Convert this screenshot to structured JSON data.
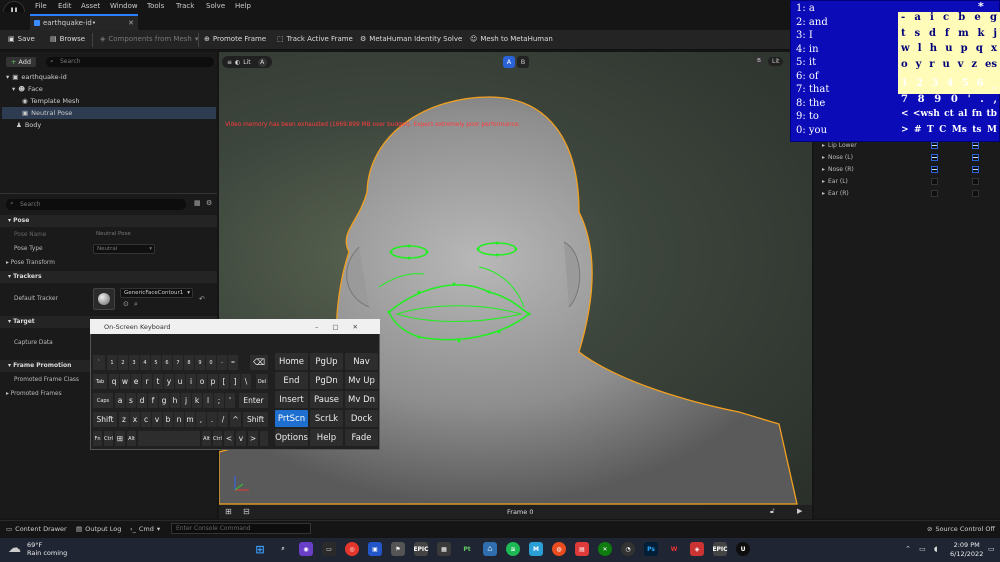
{
  "menubar": {
    "items": [
      "File",
      "Edit",
      "Asset",
      "Window",
      "Tools",
      "Track",
      "Solve",
      "Help"
    ]
  },
  "document_tab": {
    "title": "earthquake-id•"
  },
  "toolbar": {
    "save": "Save",
    "browse": "Browse",
    "components": "Components from Mesh",
    "promote": "Promote Frame",
    "track": "Track Active Frame",
    "identity_solve": "MetaHuman Identity Solve",
    "mesh_to_mh": "Mesh to MetaHuman"
  },
  "outliner": {
    "add": "Add",
    "search_placeholder": "Search",
    "tree": [
      {
        "label": "earthquake-id",
        "indent": 0
      },
      {
        "label": "Face",
        "indent": 1
      },
      {
        "label": "Template Mesh",
        "indent": 2
      },
      {
        "label": "Neutral Pose",
        "indent": 2,
        "selected": true
      },
      {
        "label": "Body",
        "indent": 1
      }
    ]
  },
  "details": {
    "search_placeholder": "Search",
    "pose_section": "Pose",
    "pose_name_label": "Pose Name",
    "pose_name_value": "Neutral Pose",
    "pose_type_label": "Pose Type",
    "pose_type_value": "Neutral",
    "pose_transform": "Pose Transform",
    "trackers_section": "Trackers",
    "default_tracker_label": "Default Tracker",
    "default_tracker_value": "GenericFaceContour1",
    "target_section": "Target",
    "capture_data_label": "Capture Data",
    "frame_promotion_section": "Frame Promotion",
    "promoted_frame_class": "Promoted Frame Class",
    "promoted_frames": "Promoted Frames"
  },
  "viewport": {
    "lit_a": "Lit",
    "view_a": "A",
    "lit_b": "Lit",
    "view_b": "B",
    "ab_a": "A",
    "ab_b": "B",
    "warning": "Video memory has been exhausted (1669.899 MB over budget). Expect extremely poor performance.",
    "frame": "Frame 0"
  },
  "right_panel": {
    "rows": [
      {
        "label": "Lip Lower",
        "c1": true,
        "c2": true
      },
      {
        "label": "Nose (L)",
        "c1": true,
        "c2": true
      },
      {
        "label": "Nose (R)",
        "c1": true,
        "c2": true
      },
      {
        "label": "Ear (L)",
        "c1": false,
        "c2": false
      },
      {
        "label": "Ear (R)",
        "c1": false,
        "c2": false
      }
    ]
  },
  "kb_helper": {
    "words": [
      "1: a",
      "2: and",
      "3: I",
      "4: in",
      "5: it",
      "6: of",
      "7: that",
      "8: the",
      "9: to",
      "0: you"
    ],
    "star": "*",
    "letter_rows": [
      [
        "-",
        "a",
        "i",
        "c",
        "b",
        "e",
        "g"
      ],
      [
        "t",
        "s",
        "d",
        "f",
        "m",
        "k",
        "j"
      ],
      [
        "w",
        "l",
        "h",
        "u",
        "p",
        "q",
        "x"
      ],
      [
        "o",
        "y",
        "r",
        "u",
        "v",
        "z",
        "es"
      ]
    ],
    "digit_rows": [
      [
        "1",
        "2",
        "3",
        "4",
        "5",
        "6",
        "_"
      ],
      [
        "7",
        "8",
        "9",
        "0",
        "'",
        ".",
        ","
      ],
      [
        "<",
        "<wsh",
        "ct",
        "al",
        "fn",
        "tb"
      ],
      [
        ">",
        "#",
        "T",
        "C",
        "Ms",
        "ts",
        "M"
      ]
    ]
  },
  "osk": {
    "title": "On-Screen Keyboard",
    "row1": [
      "`",
      "1",
      "2",
      "3",
      "4",
      "5",
      "6",
      "7",
      "8",
      "9",
      "0",
      "-",
      "="
    ],
    "row2": [
      "q",
      "w",
      "e",
      "r",
      "t",
      "y",
      "u",
      "i",
      "o",
      "p",
      "[",
      "]",
      "\\"
    ],
    "row3": [
      "a",
      "s",
      "d",
      "f",
      "g",
      "h",
      "j",
      "k",
      "l",
      ";",
      "'"
    ],
    "row4": [
      "z",
      "x",
      "c",
      "v",
      "b",
      "n",
      "m",
      ",",
      ".",
      "/"
    ],
    "tab": "Tab",
    "caps": "Caps",
    "shift": "Shift",
    "shift_r": "Shift",
    "enter": "Enter",
    "del": "Del",
    "fn": "Fn",
    "alt": "Alt",
    "ctrl": "Ctrl",
    "nav": [
      "Home",
      "PgUp",
      "Nav",
      "End",
      "PgDn",
      "Mv Up",
      "Insert",
      "Pause",
      "Mv Dn",
      "PrtScn",
      "ScrLk",
      "Dock",
      "Options",
      "Help",
      "Fade"
    ]
  },
  "statusbar": {
    "content_drawer": "Content Drawer",
    "output_log": "Output Log",
    "cmd": "Cmd",
    "console_placeholder": "Enter Console Command",
    "source_control": "Source Control Off"
  },
  "taskbar": {
    "temp": "69°F",
    "weather": "Rain coming",
    "time": "2:09 PM",
    "date": "6/12/2022"
  }
}
